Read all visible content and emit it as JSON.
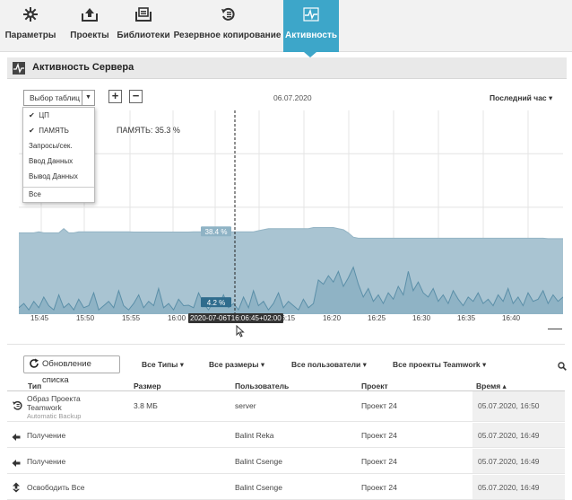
{
  "nav": {
    "tabs": [
      {
        "label": "Параметры",
        "icon": "gear-icon"
      },
      {
        "label": "Проекты",
        "icon": "projects-upload-icon"
      },
      {
        "label": "Библиотеки",
        "icon": "library-icon"
      },
      {
        "label": "Резервное копирование",
        "icon": "backup-restore-icon"
      },
      {
        "label": "Активность",
        "icon": "activity-pulse-icon",
        "active": true
      }
    ]
  },
  "section": {
    "title": "Активность Сервера",
    "icon": "activity-pulse-icon"
  },
  "chart_toolbar": {
    "table_select": "Выбор таблиц",
    "plus": "+",
    "minus": "−",
    "date": "06.07.2020",
    "range": "Последний час ▾"
  },
  "table_menu": {
    "items": [
      {
        "label": "ЦП",
        "checked": true,
        "check": "✔"
      },
      {
        "label": "ПАМЯТЬ",
        "checked": true,
        "check": "✔"
      },
      {
        "label": "Запросы/сек.",
        "checked": false,
        "check": ""
      },
      {
        "label": "Ввод Данных",
        "checked": false,
        "check": ""
      },
      {
        "label": "Вывод Данных",
        "checked": false,
        "check": ""
      },
      {
        "label": "Все",
        "checked": false,
        "check": ""
      }
    ]
  },
  "chart_data": {
    "type": "area",
    "memory_label": "ПАМЯТЬ: 35.3 %",
    "cursor_label": "2020-07-06T16:06:45+02:00",
    "memory_value_label": "38.4 %",
    "cpu_value_label": "4.2 %",
    "x_ticks": [
      "15:45",
      "15:50",
      "15:55",
      "16:00",
      "16:15",
      "16:20",
      "16:25",
      "16:30",
      "16:35",
      "16:40"
    ],
    "ylim": [
      0,
      100
    ],
    "grid": true,
    "colors": {
      "memory": "#a9c4d2",
      "cpu": "#8fb3c5",
      "line": "#5b8fa8"
    },
    "series": [
      {
        "name": "ПАМЯТЬ",
        "values": [
          38,
          38,
          38,
          38,
          38.5,
          38,
          38,
          38,
          38,
          40,
          38,
          38,
          38.5,
          38.5,
          38.5,
          38.5,
          38.5,
          38.5,
          38.5,
          38.5,
          38.5,
          38.5,
          38.5,
          38.4,
          38.4,
          38.4,
          38.4,
          38.4,
          38.4,
          38.4,
          38.4,
          38.4,
          38.4,
          38.4,
          38.4,
          38.5,
          38.5,
          38.5,
          38.5,
          38.5,
          38.5,
          38.5,
          38.5,
          38.5,
          38.5,
          38.5,
          38.5,
          38.5,
          39,
          39.5,
          40,
          40,
          40,
          40,
          40,
          40,
          40,
          40,
          40,
          40.5,
          40.5,
          40.5,
          40.5,
          40.5,
          40,
          39.5,
          38,
          36,
          35.5,
          35.5,
          35.5,
          35.5,
          35.5,
          35.5,
          35.5,
          35.5,
          35.5,
          35.5,
          35.5,
          35.5,
          35.5,
          35.5,
          35.5,
          35.5,
          35.5,
          35.5,
          35.5,
          35.5,
          35.5,
          35.5,
          35.5,
          35.5,
          35.5,
          35.5,
          35.5,
          35.5,
          35.5,
          35.5,
          35.5,
          35.5,
          35.5,
          35.5,
          35.5,
          35.5,
          35.5,
          35.5,
          35.3,
          35.3,
          35.3,
          35.3
        ]
      },
      {
        "name": "ЦП",
        "values": [
          3,
          5,
          2,
          6,
          3,
          8,
          4,
          2,
          9,
          3,
          5,
          2,
          7,
          3,
          4,
          10,
          2,
          4,
          6,
          3,
          11,
          4,
          2,
          5,
          9,
          3,
          6,
          4,
          12,
          3,
          5,
          2,
          7,
          4,
          4.2,
          3,
          10,
          5,
          2,
          6,
          4,
          9,
          3,
          5,
          2,
          8,
          3,
          11,
          4,
          6,
          2,
          5,
          10,
          3,
          6,
          4,
          2,
          7,
          3,
          5,
          16,
          14,
          18,
          15,
          20,
          13,
          17,
          22,
          14,
          8,
          12,
          6,
          9,
          5,
          10,
          7,
          13,
          9,
          20,
          11,
          15,
          10,
          8,
          12,
          6,
          9,
          5,
          11,
          7,
          4,
          8,
          6,
          10,
          5,
          7,
          4,
          9,
          6,
          12,
          5,
          8,
          4,
          10,
          6,
          7,
          11,
          5,
          9,
          6,
          8
        ]
      }
    ]
  },
  "filters": {
    "refresh": "Обновление списка",
    "types": "Все Типы ▾",
    "sizes": "Все размеры ▾",
    "users": "Все пользователи ▾",
    "projects": "Все проекты Teamwork ▾"
  },
  "table": {
    "columns": [
      "Тип",
      "Размер",
      "Пользователь",
      "Проект",
      "Время ▴"
    ],
    "rows": [
      {
        "icon": "backup-restore-icon",
        "type": "Образ Проекта",
        "type_line2": "Teamwork",
        "sub": "Automatic Backup",
        "size": "3.8 МБ",
        "user": "server",
        "project": "Проект 24",
        "time": "05.07.2020, 16:50"
      },
      {
        "icon": "receive-arrow-icon",
        "type": "Получение",
        "size": "",
        "user": "Balint Reka",
        "project": "Проект 24",
        "time": "05.07.2020, 16:49"
      },
      {
        "icon": "receive-arrow-icon",
        "type": "Получение",
        "size": "",
        "user": "Balint Csenge",
        "project": "Проект 24",
        "time": "05.07.2020, 16:49"
      },
      {
        "icon": "release-all-icon",
        "type": "Освободить Все",
        "size": "",
        "user": "Balint Csenge",
        "project": "Проект 24",
        "time": "05.07.2020, 16:49"
      }
    ]
  }
}
